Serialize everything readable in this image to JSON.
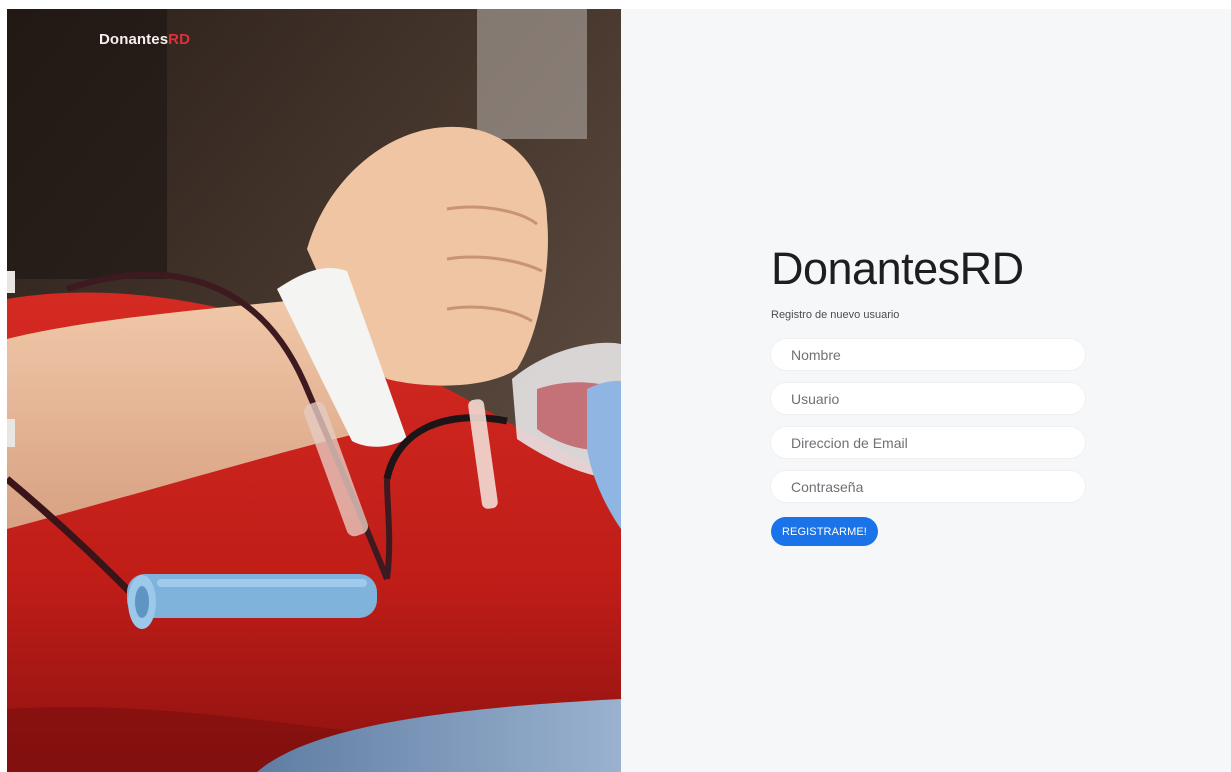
{
  "brand": {
    "name_main": "Donantes",
    "name_accent": "RD",
    "title": "DonantesRD",
    "accent_color": "#e0313b"
  },
  "form": {
    "subtitle": "Registro de nuevo usuario",
    "fields": {
      "nombre_placeholder": "Nombre",
      "usuario_placeholder": "Usuario",
      "email_placeholder": "Direccion de Email",
      "password_placeholder": "Contraseña"
    },
    "submit_label": "REGISTRARME!",
    "button_color": "#1a73e8"
  }
}
